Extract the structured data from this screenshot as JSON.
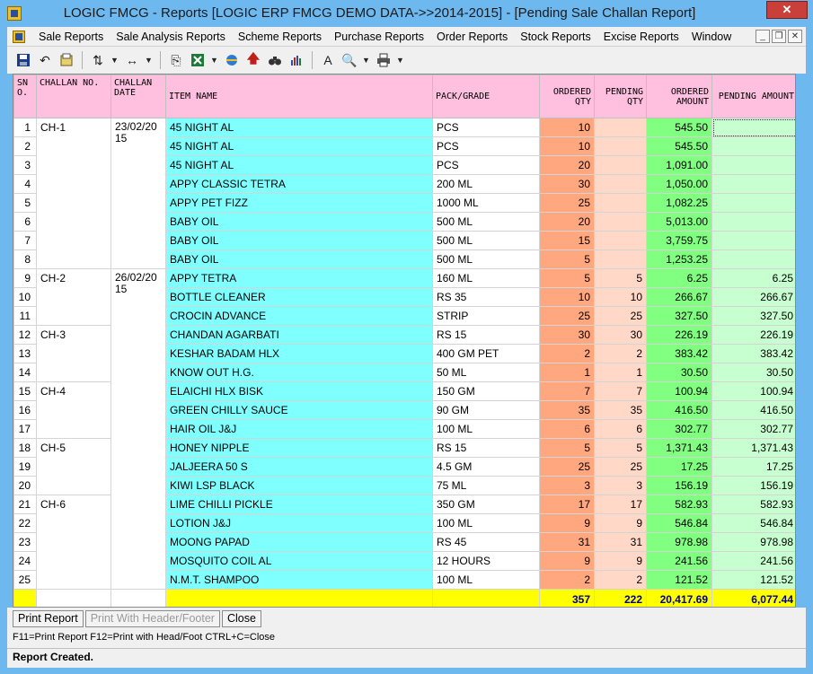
{
  "window": {
    "title": "LOGIC FMCG - Reports  [LOGIC ERP FMCG DEMO DATA->>2014-2015] - [Pending Sale Challan Report]",
    "close_label": "✕"
  },
  "menu": {
    "items": [
      "Sale Reports",
      "Sale Analysis Reports",
      "Scheme Reports",
      "Purchase Reports",
      "Order Reports",
      "Stock Reports",
      "Excise Reports",
      "Window"
    ]
  },
  "mdi": {
    "minimize": "_",
    "restore": "❐",
    "close": "✕"
  },
  "table": {
    "headers": {
      "sno": "SN O.",
      "challan_no": "CHALLAN NO.",
      "challan_date": "CHALLAN DATE",
      "item": "ITEM NAME",
      "pack": "PACK/GRADE",
      "ordered_qty": "ORDERED QTY",
      "pending_qty": "PENDING QTY",
      "ordered_amount": "ORDERED AMOUNT",
      "pending_amount": "PENDING AMOUNT"
    },
    "rows": [
      {
        "sno": "1",
        "challan": "CH-1",
        "date": "23/02/2015",
        "item": "45 NIGHT AL",
        "pack": "PCS",
        "oq": "10",
        "pq": "",
        "oa": "545.50",
        "pa": ""
      },
      {
        "sno": "2",
        "challan": "",
        "date": "",
        "item": "45 NIGHT AL",
        "pack": "PCS",
        "oq": "10",
        "pq": "",
        "oa": "545.50",
        "pa": ""
      },
      {
        "sno": "3",
        "challan": "",
        "date": "",
        "item": "45 NIGHT AL",
        "pack": "PCS",
        "oq": "20",
        "pq": "",
        "oa": "1,091.00",
        "pa": ""
      },
      {
        "sno": "4",
        "challan": "",
        "date": "",
        "item": "APPY CLASSIC TETRA",
        "pack": "200 ML",
        "oq": "30",
        "pq": "",
        "oa": "1,050.00",
        "pa": ""
      },
      {
        "sno": "5",
        "challan": "",
        "date": "",
        "item": "APPY PET FIZZ",
        "pack": "1000 ML",
        "oq": "25",
        "pq": "",
        "oa": "1,082.25",
        "pa": ""
      },
      {
        "sno": "6",
        "challan": "",
        "date": "",
        "item": "BABY OIL",
        "pack": "500 ML",
        "oq": "20",
        "pq": "",
        "oa": "5,013.00",
        "pa": ""
      },
      {
        "sno": "7",
        "challan": "",
        "date": "",
        "item": "BABY OIL",
        "pack": "500 ML",
        "oq": "15",
        "pq": "",
        "oa": "3,759.75",
        "pa": ""
      },
      {
        "sno": "8",
        "challan": "",
        "date": "",
        "item": "BABY OIL",
        "pack": "500 ML",
        "oq": "5",
        "pq": "",
        "oa": "1,253.25",
        "pa": ""
      },
      {
        "sno": "9",
        "challan": "CH-2",
        "date": "26/02/2015",
        "item": "APPY TETRA",
        "pack": "160 ML",
        "oq": "5",
        "pq": "5",
        "oa": "6.25",
        "pa": "6.25"
      },
      {
        "sno": "10",
        "challan": "",
        "date": "",
        "item": "BOTTLE CLEANER",
        "pack": "RS 35",
        "oq": "10",
        "pq": "10",
        "oa": "266.67",
        "pa": "266.67"
      },
      {
        "sno": "11",
        "challan": "",
        "date": "",
        "item": "CROCIN ADVANCE",
        "pack": "STRIP",
        "oq": "25",
        "pq": "25",
        "oa": "327.50",
        "pa": "327.50"
      },
      {
        "sno": "12",
        "challan": "CH-3",
        "date": "",
        "item": "CHANDAN AGARBATI",
        "pack": "RS 15",
        "oq": "30",
        "pq": "30",
        "oa": "226.19",
        "pa": "226.19"
      },
      {
        "sno": "13",
        "challan": "",
        "date": "",
        "item": "KESHAR BADAM HLX",
        "pack": "400 GM PET",
        "oq": "2",
        "pq": "2",
        "oa": "383.42",
        "pa": "383.42"
      },
      {
        "sno": "14",
        "challan": "",
        "date": "",
        "item": "KNOW OUT H.G.",
        "pack": "50 ML",
        "oq": "1",
        "pq": "1",
        "oa": "30.50",
        "pa": "30.50"
      },
      {
        "sno": "15",
        "challan": "CH-4",
        "date": "",
        "item": "ELAICHI HLX BISK",
        "pack": "150 GM",
        "oq": "7",
        "pq": "7",
        "oa": "100.94",
        "pa": "100.94"
      },
      {
        "sno": "16",
        "challan": "",
        "date": "",
        "item": "GREEN CHILLY SAUCE",
        "pack": "90 GM",
        "oq": "35",
        "pq": "35",
        "oa": "416.50",
        "pa": "416.50"
      },
      {
        "sno": "17",
        "challan": "",
        "date": "",
        "item": "HAIR OIL J&J",
        "pack": "100 ML",
        "oq": "6",
        "pq": "6",
        "oa": "302.77",
        "pa": "302.77"
      },
      {
        "sno": "18",
        "challan": "CH-5",
        "date": "",
        "item": "HONEY NIPPLE",
        "pack": "RS 15",
        "oq": "5",
        "pq": "5",
        "oa": "1,371.43",
        "pa": "1,371.43"
      },
      {
        "sno": "19",
        "challan": "",
        "date": "",
        "item": "JALJEERA 50 S",
        "pack": "4.5 GM",
        "oq": "25",
        "pq": "25",
        "oa": "17.25",
        "pa": "17.25"
      },
      {
        "sno": "20",
        "challan": "",
        "date": "",
        "item": "KIWI LSP BLACK",
        "pack": "75 ML",
        "oq": "3",
        "pq": "3",
        "oa": "156.19",
        "pa": "156.19"
      },
      {
        "sno": "21",
        "challan": "CH-6",
        "date": "",
        "item": "LIME CHILLI PICKLE",
        "pack": "350 GM",
        "oq": "17",
        "pq": "17",
        "oa": "582.93",
        "pa": "582.93"
      },
      {
        "sno": "22",
        "challan": "",
        "date": "",
        "item": "LOTION J&J",
        "pack": "100 ML",
        "oq": "9",
        "pq": "9",
        "oa": "546.84",
        "pa": "546.84"
      },
      {
        "sno": "23",
        "challan": "",
        "date": "",
        "item": "MOONG PAPAD",
        "pack": "RS 45",
        "oq": "31",
        "pq": "31",
        "oa": "978.98",
        "pa": "978.98"
      },
      {
        "sno": "24",
        "challan": "",
        "date": "",
        "item": "MOSQUITO COIL AL",
        "pack": "12 HOURS",
        "oq": "9",
        "pq": "9",
        "oa": "241.56",
        "pa": "241.56"
      },
      {
        "sno": "25",
        "challan": "",
        "date": "",
        "item": "N.M.T. SHAMPOO",
        "pack": "100 ML",
        "oq": "2",
        "pq": "2",
        "oa": "121.52",
        "pa": "121.52"
      }
    ],
    "totals": {
      "oq": "357",
      "pq": "222",
      "oa": "20,417.69",
      "pa": "6,077.44"
    }
  },
  "buttons": {
    "print_report": "Print Report",
    "print_header_footer": "Print With Header/Footer",
    "close": "Close"
  },
  "hint": "F11=Print Report  F12=Print with Head/Foot  CTRL+C=Close",
  "status": "Report Created.",
  "colors": {
    "header": "#ffc0e0",
    "item": "#80ffff",
    "ordered_qty": "#ffa880",
    "pending_qty": "#ffd8c8",
    "ordered_amount": "#80ff80",
    "pending_amount": "#c8ffd0",
    "total_row": "#ffff00"
  }
}
